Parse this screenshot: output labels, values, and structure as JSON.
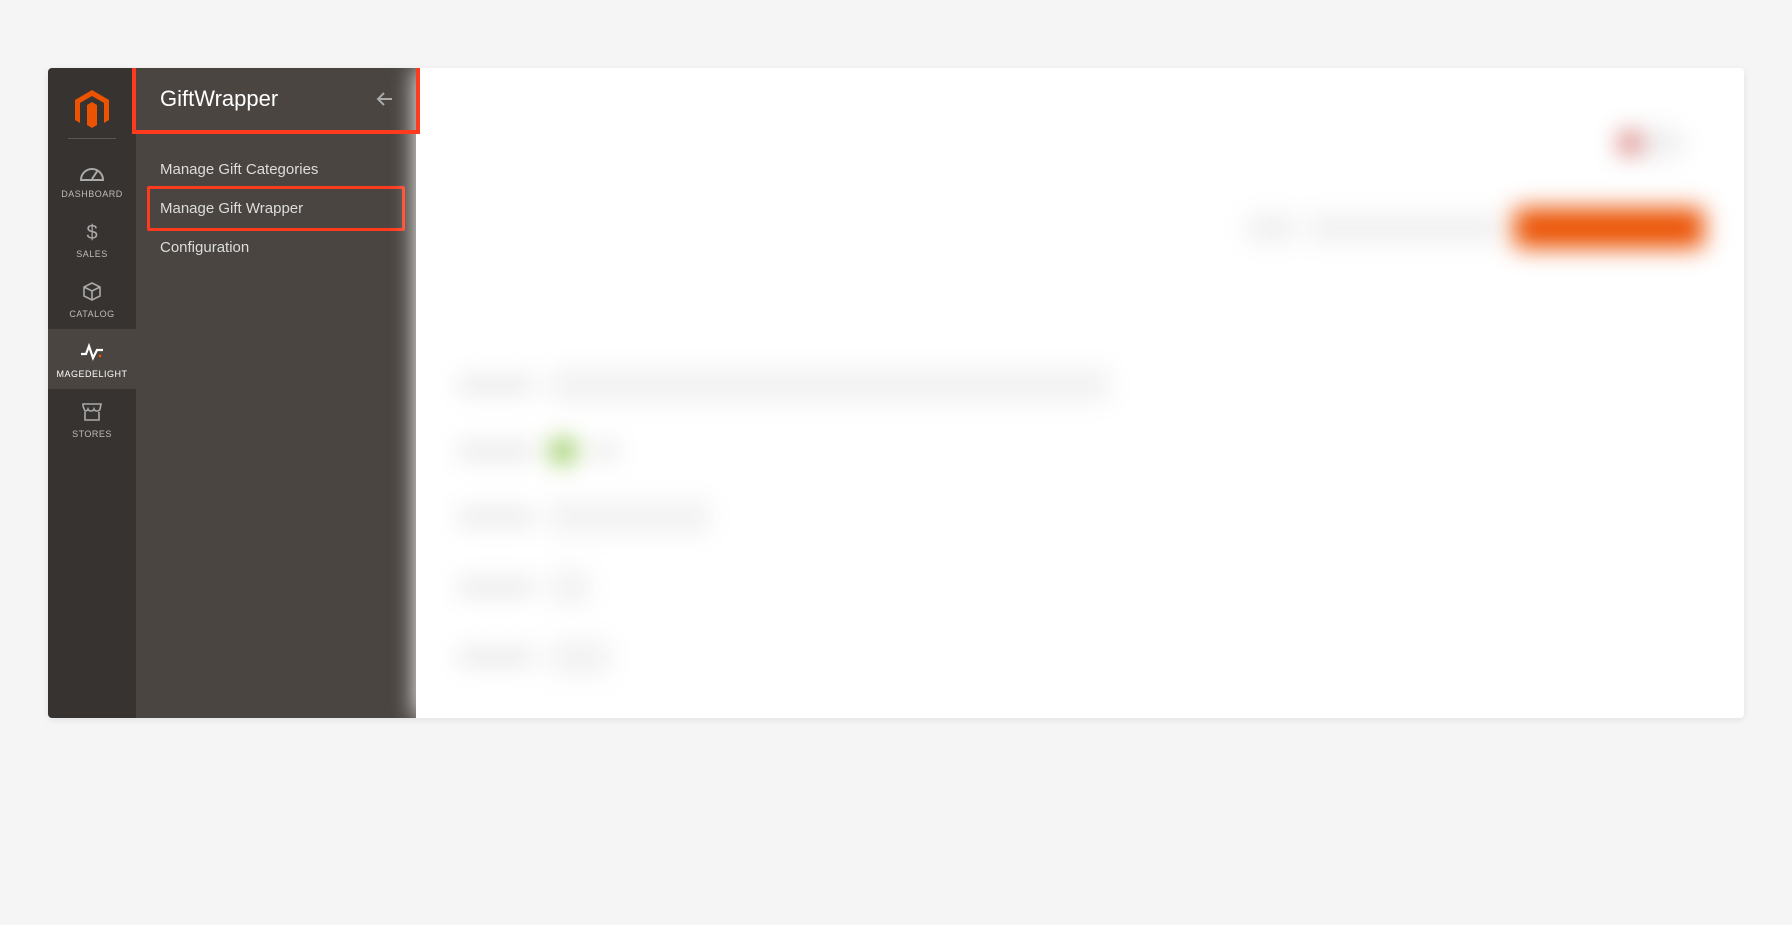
{
  "nav": {
    "items": [
      {
        "label": "DASHBOARD",
        "icon": "gauge"
      },
      {
        "label": "SALES",
        "icon": "dollar"
      },
      {
        "label": "CATALOG",
        "icon": "cube"
      },
      {
        "label": "MAGEDELIGHT",
        "icon": "pulse"
      },
      {
        "label": "STORES",
        "icon": "store"
      }
    ]
  },
  "flyout": {
    "title": "GiftWrapper",
    "items": [
      {
        "label": "Manage Gift Categories"
      },
      {
        "label": "Manage Gift Wrapper"
      },
      {
        "label": "Configuration"
      }
    ]
  },
  "colors": {
    "accent": "#eb5202",
    "highlight": "#ff3b1f",
    "railBg": "#373330",
    "flyoutBg": "#4a4541"
  }
}
